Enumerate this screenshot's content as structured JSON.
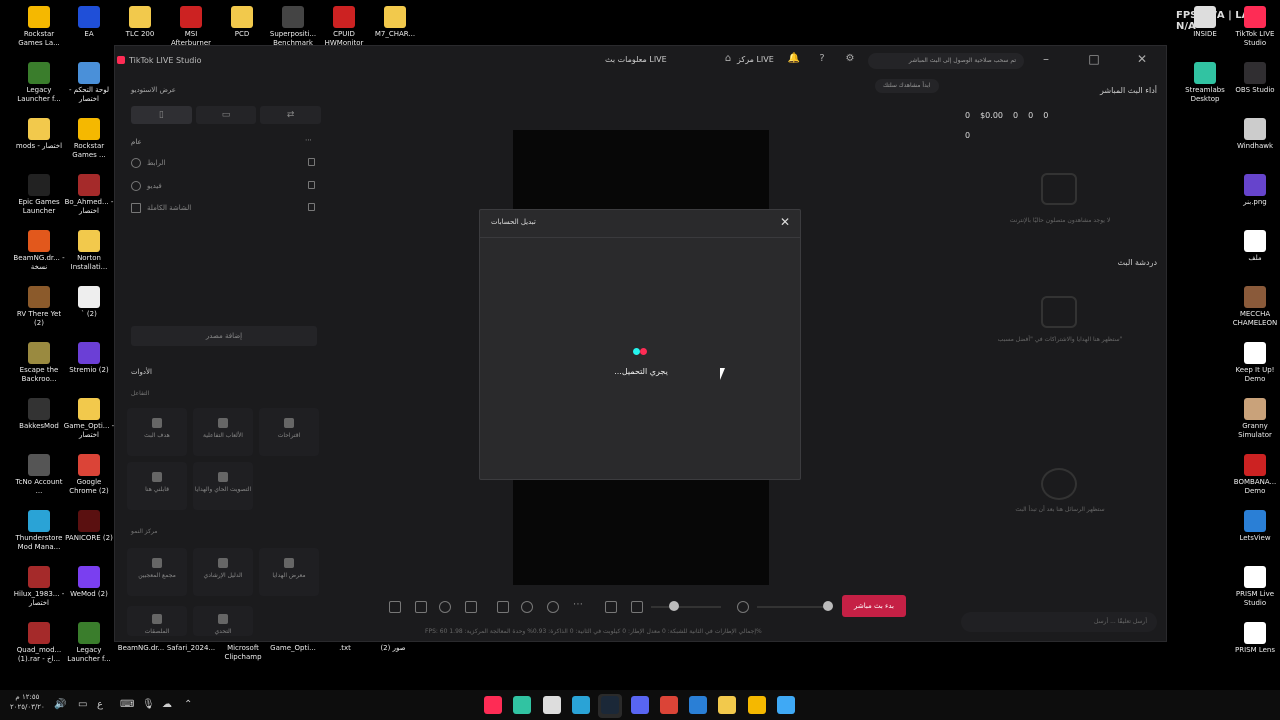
{
  "desktop": {
    "left_icons": [
      {
        "label": "Rockstar Games La...",
        "color": "#f5b800"
      },
      {
        "label": "EA",
        "color": "#1f4fd8"
      },
      {
        "label": "Legacy Launcher f...",
        "color": "#3a7d2c"
      },
      {
        "label": "لوحة التحكم - اختصار",
        "color": "#4a90d9"
      },
      {
        "label": "mods - اختصار",
        "color": "#f2c94c"
      },
      {
        "label": "Rockstar Games ...",
        "color": "#f5b800"
      },
      {
        "label": "Epic Games Launcher",
        "color": "#222222"
      },
      {
        "label": "Bo_Ahmed... - اختصار",
        "color": "#a52a2a"
      },
      {
        "label": "BeamNG.dr... - نسخة",
        "color": "#e2581c"
      },
      {
        "label": "Norton Installati...",
        "color": "#f2c94c"
      },
      {
        "label": "RV There Yet (2)",
        "color": "#8b5a2b"
      },
      {
        "label": "` (2)",
        "color": "#eeeeee"
      },
      {
        "label": "Escape the Backroo...",
        "color": "#9a8a40"
      },
      {
        "label": "Stremio (2)",
        "color": "#6b3fd6"
      },
      {
        "label": "BakkesMod",
        "color": "#333333"
      },
      {
        "label": "Game_Opti... - اختصار",
        "color": "#f2c94c"
      },
      {
        "label": "TcNo Account ...",
        "color": "#555555"
      },
      {
        "label": "Google Chrome (2)",
        "color": "#db4437"
      },
      {
        "label": "Thunderstore Mod Mana...",
        "color": "#2aa3d6"
      },
      {
        "label": "PANICORE (2)",
        "color": "#5a1010"
      },
      {
        "label": "Hilux_1983... - اختصار",
        "color": "#a52a2a"
      },
      {
        "label": "WeMod (2)",
        "color": "#7a3ff0"
      },
      {
        "label": "Quad_mod... (1).rar - اخ...",
        "color": "#a52a2a"
      },
      {
        "label": "Legacy Launcher f...",
        "color": "#3a7d2c"
      }
    ],
    "top_icons": [
      {
        "label": "TLC 200",
        "color": "#f2c94c"
      },
      {
        "label": "MSI Afterburner",
        "color": "#cc2222"
      },
      {
        "label": "PCD",
        "color": "#f2c94c"
      },
      {
        "label": "Superpositi... Benchmark",
        "color": "#444444"
      },
      {
        "label": "CPUID HWMonitor",
        "color": "#cc2222"
      },
      {
        "label": "M7_CHAR...",
        "color": "#f2c94c"
      }
    ],
    "right_icons": [
      {
        "label": "INSIDE",
        "color": "#dddddd"
      },
      {
        "label": "TikTok LIVE Studio",
        "color": "#fe2c55"
      },
      {
        "label": "Streamlabs Desktop",
        "color": "#31c3a2"
      },
      {
        "label": "OBS Studio",
        "color": "#302e31"
      },
      {
        "label": "Windhawk",
        "color": "#cccccc"
      },
      {
        "label": "بنر.png",
        "color": "#6644cc"
      },
      {
        "label": "ملف",
        "color": "#ffffff"
      },
      {
        "label": "MECCHA CHAMELEON",
        "color": "#8a5a3a"
      },
      {
        "label": "Keep It Up! Demo",
        "color": "#ffffff"
      },
      {
        "label": "Granny Simulator",
        "color": "#c9a27a"
      },
      {
        "label": "BOMBANA... Demo",
        "color": "#cc2222"
      },
      {
        "label": "LetsView",
        "color": "#2a7fd6"
      },
      {
        "label": "PRISM Live Studio",
        "color": "#ffffff"
      },
      {
        "label": "PRISM Lens",
        "color": "#ffffff"
      }
    ],
    "bottom_row": [
      "BeamNG.dr...",
      "Safari_2024...",
      "Microsoft Clipchamp",
      "Game_Opti...",
      ".txt",
      "(2) صور"
    ],
    "fps_overlay": "FPS: N/A  |  LAT: N/A"
  },
  "app": {
    "title": "TikTok LIVE Studio",
    "header": {
      "live_center": "مركز LIVE",
      "live_info": "معلومات بث LIVE",
      "notice": "تم سحب صلاحية الوصول إلى البث المباشر"
    },
    "left": {
      "studio_view": "عرض الاستوديو",
      "scene_label": "عام",
      "sources": [
        "الرابط",
        "فيديو",
        "الشاشة الكاملة"
      ],
      "add_source": "إضافة مصدر",
      "tools_title": "الأدوات",
      "interaction_title": "التفاعل",
      "tools_interaction": [
        "هدف البث",
        "الألعاب التفاعلية",
        "اقتراحات",
        "قابلني هنا",
        "التصويت الحاي والهدايا"
      ],
      "growth_title": "مركز النمو",
      "tools_growth": [
        "مجمع المعجبين",
        "الدليل الإرشادي",
        "معرض الهدايا",
        "الملصقات",
        "التحدي"
      ]
    },
    "center": {
      "vtag": "ابدأ مشاهدك سلتك",
      "golive": "بدء بث مباشر",
      "status": "FPS: 60   إجمالي الإطارات في الثانية للشبكة: 0   معدل الإطار: 0   كيلوبت في الثانية: 0   الذاكرة: 0.93%   وحدة المعالجة المركزية: 1.98%"
    },
    "right": {
      "live_perf": "أداء البث المباشر",
      "stats": [
        "0",
        "$0.00",
        "0",
        "0",
        "0"
      ],
      "stats2": "0",
      "no_viewers": "لا يوجد مشاهدون متصلون حاليًا بالإنترنت",
      "chat_title": "دردشة البث",
      "gifts_empty": "ستظهر هنا الهدايا والاشتراكات في \"أفضل مسبب\"",
      "chat_empty": "ستظهر الرسائل هنا بعد أن تبدأ البث",
      "chat_placeholder": "أرسل تعليقًا ... أرسل"
    },
    "modal": {
      "title": "تبديل الحسابات",
      "loading": "...يجري التحميل"
    }
  },
  "taskbar": {
    "time": "١٢:٥٥ م",
    "date": "٢٠٢٥/٠٣/٢٠",
    "apps": [
      {
        "name": "tiktok-live-icon",
        "color": "#fe2c55"
      },
      {
        "name": "streamlabs-icon",
        "color": "#31c3a2"
      },
      {
        "name": "inkscape-icon",
        "color": "#dddddd"
      },
      {
        "name": "letsview-icon",
        "color": "#2aa3d6"
      },
      {
        "name": "steam-icon",
        "color": "#1b2838"
      },
      {
        "name": "discord-icon",
        "color": "#5865f2"
      },
      {
        "name": "chrome-icon",
        "color": "#db4437"
      },
      {
        "name": "store-icon",
        "color": "#2a7fd6"
      },
      {
        "name": "explorer-icon",
        "color": "#f2c94c"
      },
      {
        "name": "rockstar-icon",
        "color": "#f5b800"
      },
      {
        "name": "start-icon",
        "color": "#3fa9f5"
      }
    ]
  }
}
